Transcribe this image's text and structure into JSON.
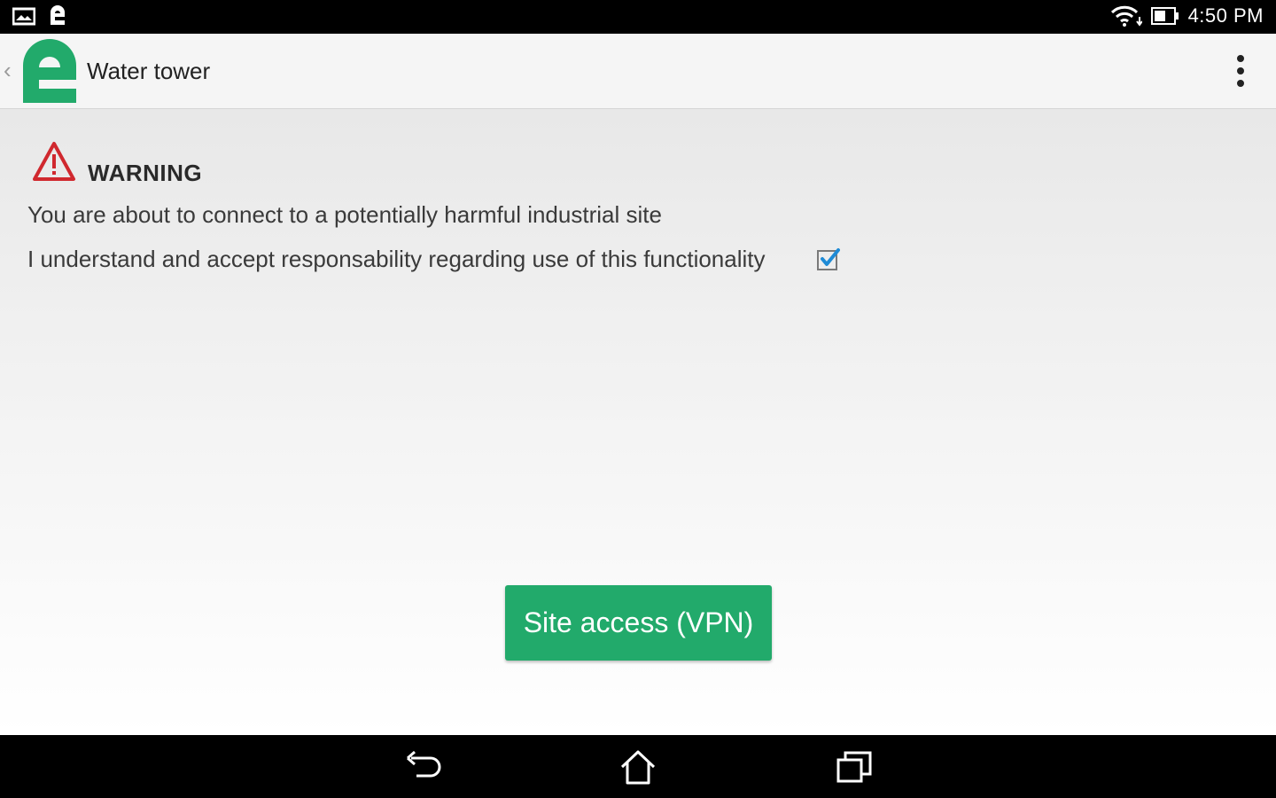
{
  "status_bar": {
    "time": "4:50 PM",
    "icons": [
      "notification-image-icon",
      "app-notification-icon",
      "wifi-icon",
      "battery-icon"
    ]
  },
  "app_bar": {
    "title": "Water tower",
    "logo": "app-logo-icon",
    "menu": "overflow-menu-icon"
  },
  "warning": {
    "title": "WARNING",
    "message": "You are about to connect to a potentially harmful industrial site",
    "accept_label": "I understand and accept responsability regarding use of this functionality",
    "accept_checked": true
  },
  "actions": {
    "vpn_button_label": "Site access (VPN)"
  },
  "nav_bar": {
    "icons": [
      "back-icon",
      "home-icon",
      "recents-icon"
    ]
  },
  "colors": {
    "brand_green": "#22aa6b",
    "warning_red": "#d0282e",
    "checkbox_blue": "#1f8bd6"
  }
}
